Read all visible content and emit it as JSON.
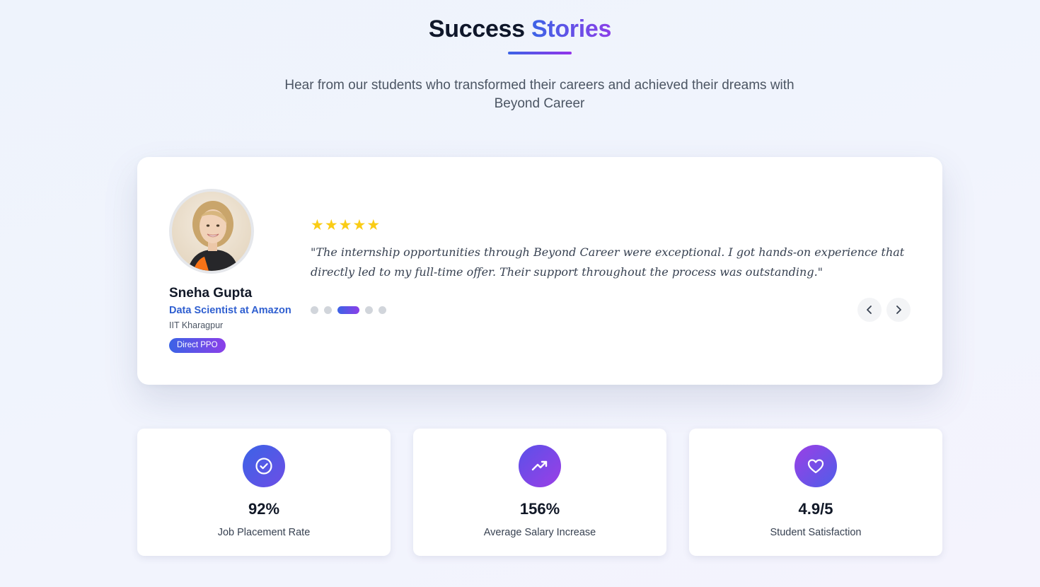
{
  "header": {
    "title_part1": "Success",
    "title_part2": "Stories",
    "subtitle": "Hear from our students who transformed their careers and achieved their dreams with Beyond Career"
  },
  "testimonial": {
    "name": "Sneha Gupta",
    "role": "Data Scientist at Amazon",
    "school": "IIT Kharagpur",
    "badge": "Direct PPO",
    "rating": 5,
    "stars": [
      "★",
      "★",
      "★",
      "★",
      "★"
    ],
    "quote": "\"The internship opportunities through Beyond Career were exceptional. I got hands-on experience that directly led to my full-time offer. Their support throughout the process was outstanding.\"",
    "carousel": {
      "total": 5,
      "active_index": 3
    },
    "prev_icon": "chevron-left-icon",
    "next_icon": "chevron-right-icon"
  },
  "stats": [
    {
      "value": "92%",
      "label": "Job Placement Rate",
      "icon": "check-circle-icon"
    },
    {
      "value": "156%",
      "label": "Average Salary Increase",
      "icon": "trending-up-icon"
    },
    {
      "value": "4.9/5",
      "label": "Student Satisfaction",
      "icon": "heart-icon"
    }
  ],
  "colors": {
    "accent_blue": "#3b63e6",
    "accent_purple": "#8b3fe8",
    "star": "#facc15",
    "role_text": "#2f5fd0"
  }
}
